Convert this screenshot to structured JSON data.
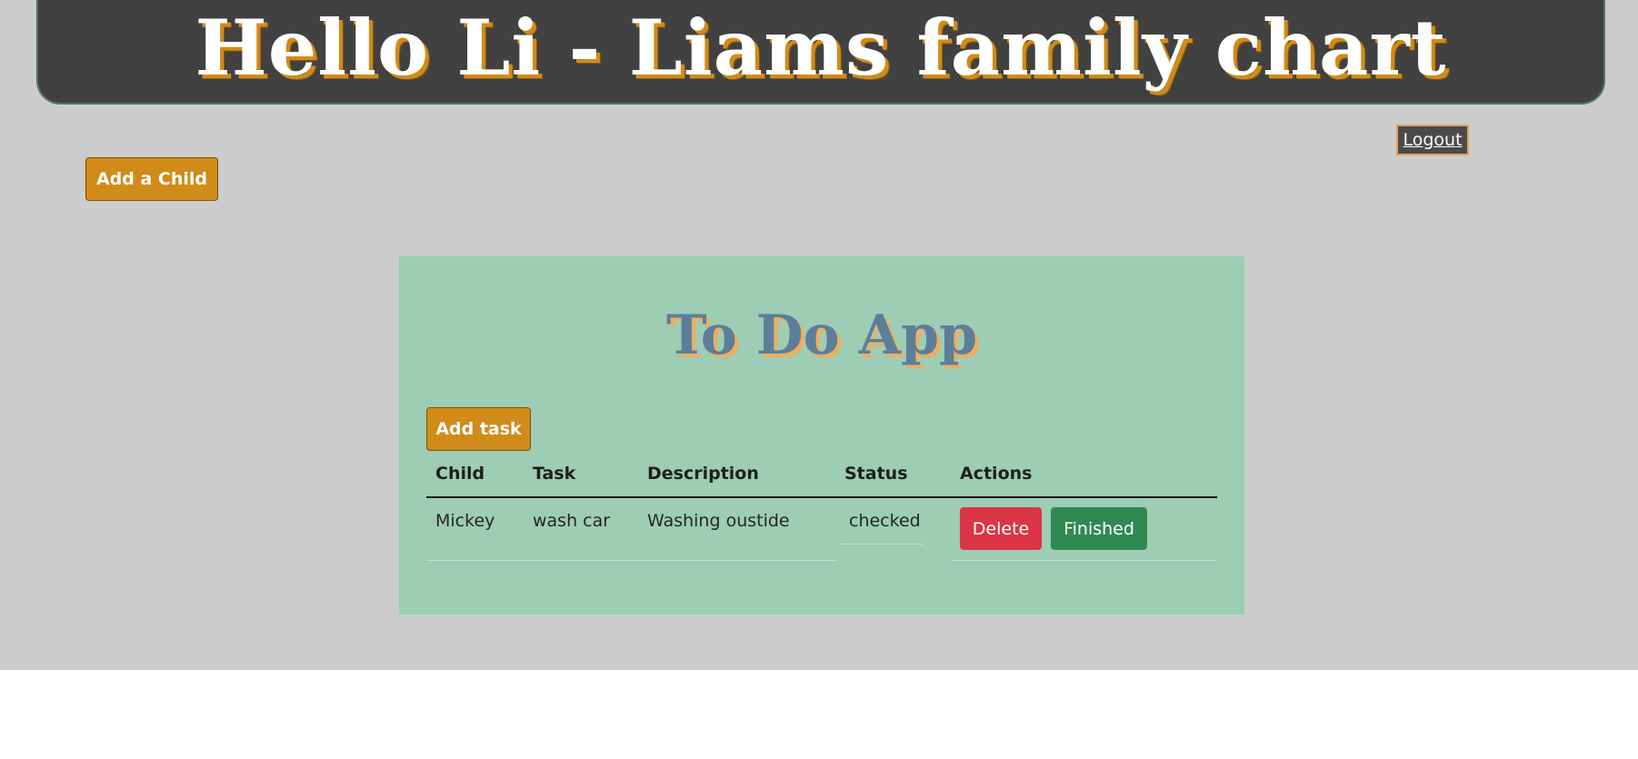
{
  "header": {
    "title": "Hello Li - Liams family chart"
  },
  "nav": {
    "logout_label": "Logout"
  },
  "actions": {
    "add_child_label": "Add a Child"
  },
  "todo": {
    "title": "To Do App",
    "add_task_label": "Add task",
    "columns": [
      "Child",
      "Task",
      "Description",
      "Status",
      "Actions"
    ],
    "rows": [
      {
        "child": "Mickey",
        "task": "wash car",
        "description": "Washing oustide",
        "status": "checked",
        "delete_label": "Delete",
        "finished_label": "Finished"
      }
    ]
  },
  "colors": {
    "page_background": "#cccccc",
    "header_background": "#414141",
    "accent_orange": "#d18b18",
    "panel_green": "#9dcdb5",
    "delete_red": "#dc3545",
    "finished_green": "#2f8a52"
  }
}
